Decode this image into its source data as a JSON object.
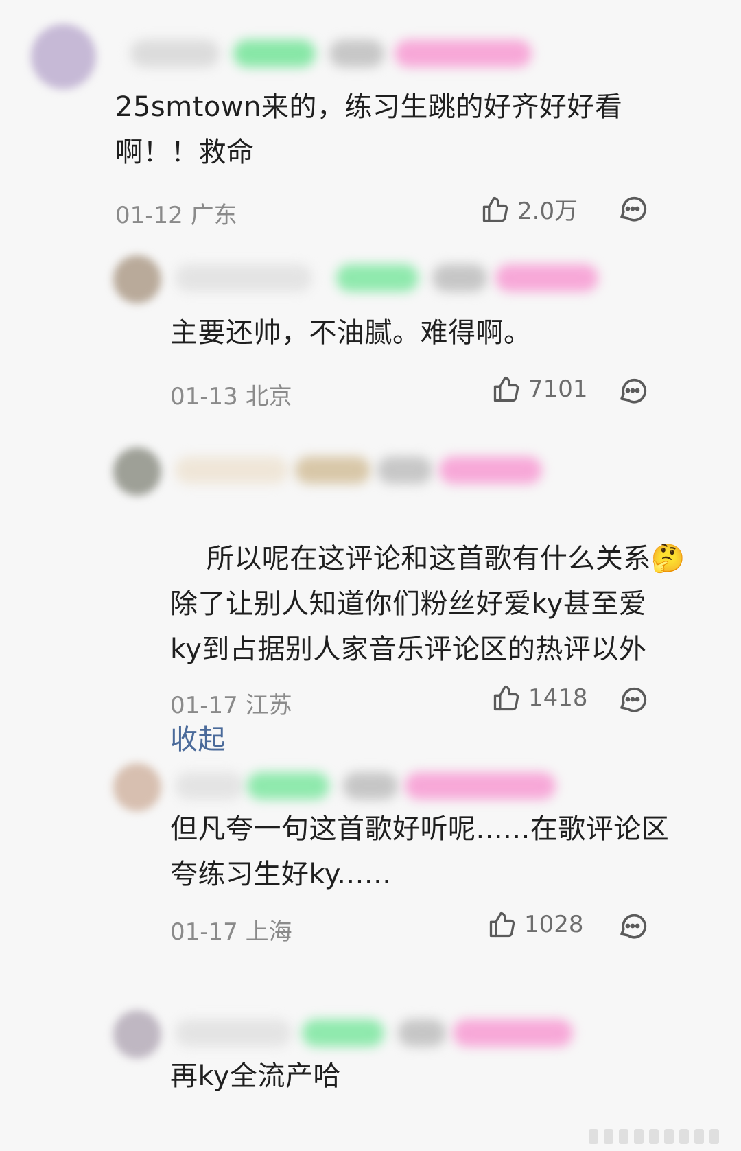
{
  "comments": [
    {
      "text": "25smtown来的，练习生跳的好齐好好看\n啊！！救命",
      "date": "01-12",
      "region": "广东",
      "likes": "2.0万",
      "colors": {
        "avatar": "#c6b9d6",
        "bar1": "#d9d9d9",
        "bar2": "#88e7a7",
        "bar3": "#c7c7c7",
        "bar4": "#f7a8d8"
      }
    },
    {
      "text": "主要还帅，不油腻。难得啊。",
      "date": "01-13",
      "region": "北京",
      "likes": "7101",
      "colors": {
        "avatar": "#b9aa9a",
        "bar1": "#e5e5e5",
        "bar2": "#8fe9ad",
        "bar3": "#c6c6c6",
        "bar4": "#f7a8d8"
      }
    },
    {
      "text": "所以呢在这评论和这首歌有什么关系🤔\n除了让别人知道你们粉丝好爱ky甚至爱\nky到占据别人家音乐评论区的热评以外",
      "collapse_label": "收起",
      "date": "01-17",
      "region": "江苏",
      "likes": "1418",
      "colors": {
        "avatar": "#9ea097",
        "bar1": "#f0e7da",
        "bar2": "#d8c7a8",
        "bar3": "#c7c7c7",
        "bar4": "#f7a8d8"
      }
    },
    {
      "text": "但凡夸一句这首歌好听呢......在歌评论区\n夸练习生好ky......",
      "date": "01-17",
      "region": "上海",
      "likes": "1028",
      "colors": {
        "avatar": "#d7bfb0",
        "bar1": "#e5e5e5",
        "bar2": "#8fe9ad",
        "bar3": "#c6c6c6",
        "bar4": "#f7a8d8"
      }
    },
    {
      "text": "再ky全流产哈",
      "colors": {
        "avatar": "#bfb7c2",
        "bar1": "#e5e5e5",
        "bar2": "#8fe9ad",
        "bar3": "#c6c6c6",
        "bar4": "#f7a8d8"
      }
    }
  ],
  "icons": {
    "like": "thumbs-up-icon",
    "reply": "chat-bubble-icon"
  }
}
